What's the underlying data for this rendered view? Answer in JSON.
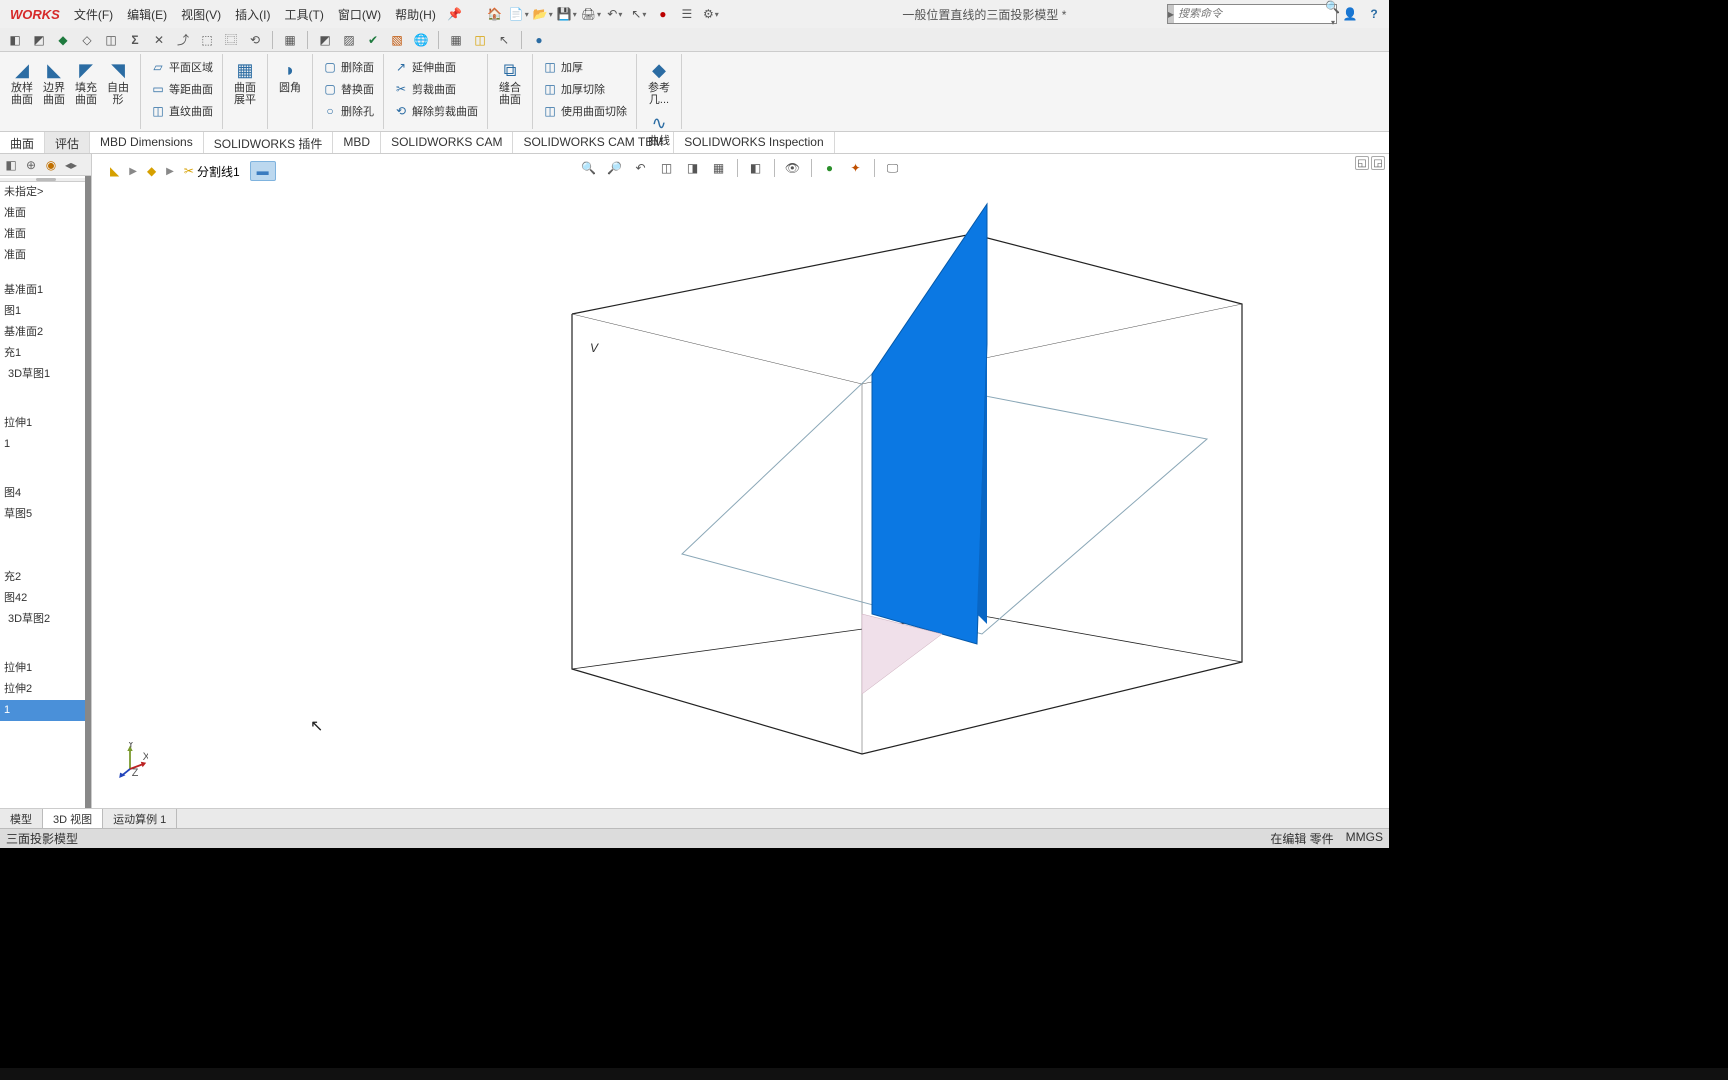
{
  "app_name": "WORKS",
  "document_title": "一般位置直线的三面投影模型 *",
  "menu": {
    "file": "文件(F)",
    "edit": "编辑(E)",
    "view": "视图(V)",
    "insert": "插入(I)",
    "tools": "工具(T)",
    "window": "窗口(W)",
    "help": "帮助(H)"
  },
  "search_placeholder": "搜索命令",
  "ribbon": {
    "r1": {
      "loft": "放样",
      "boundary": "边界",
      "fill": "填充",
      "free": "自由"
    },
    "r1b": {
      "surf": "曲面",
      "surf2": "曲面",
      "surf3": "曲面",
      "shape": "形"
    },
    "r2": {
      "planar": "平面区域",
      "ruled": "等距曲面",
      "ruled2": "直纹曲面"
    },
    "r3": {
      "flat": "曲面",
      "flat2": "展平"
    },
    "r4": {
      "fillet": "圆角"
    },
    "r5": {
      "delface": "删除面",
      "repface": "替换面",
      "delhole": "删除孔"
    },
    "r6": {
      "ext": "延伸曲面",
      "trim": "剪裁曲面",
      "untrim": "解除剪裁曲面"
    },
    "r7": {
      "knit": "缝合",
      "surf": "曲面"
    },
    "r8": {
      "thicken": "加厚",
      "thickcut": "加厚切除",
      "usecut": "使用曲面切除"
    },
    "r9": {
      "ref": "参考",
      "geo": "几..."
    },
    "r10": {
      "curve": "曲线"
    }
  },
  "tabs": {
    "t0": "曲面",
    "t1": "评估",
    "t2": "MBD Dimensions",
    "t3": "SOLIDWORKS 插件",
    "t4": "MBD",
    "t5": "SOLIDWORKS CAM",
    "t6": "SOLIDWORKS CAM TBM",
    "t7": "SOLIDWORKS Inspection"
  },
  "feature_tree": {
    "header": "未指定>",
    "items": [
      "准面",
      "准面",
      "准面",
      "",
      "基准面1",
      "图1",
      "基准面2",
      "充1",
      "3D草图1",
      "",
      "",
      "拉伸1",
      "1",
      "",
      "",
      "图4",
      "草图5",
      "",
      "",
      "",
      "充2",
      "图42",
      "3D草图2",
      "",
      "",
      "拉伸1",
      "拉伸2",
      "1"
    ]
  },
  "breadcrumb": {
    "seg1": "分割线1",
    "seg2_icon": "selection"
  },
  "viewport_label": "V",
  "bottom_tabs": {
    "bt0": "模型",
    "bt1": "3D 视图",
    "bt2": "运动算例 1"
  },
  "status_left": "三面投影模型",
  "status_mode": "在编辑 零件",
  "status_units": "MMGS"
}
